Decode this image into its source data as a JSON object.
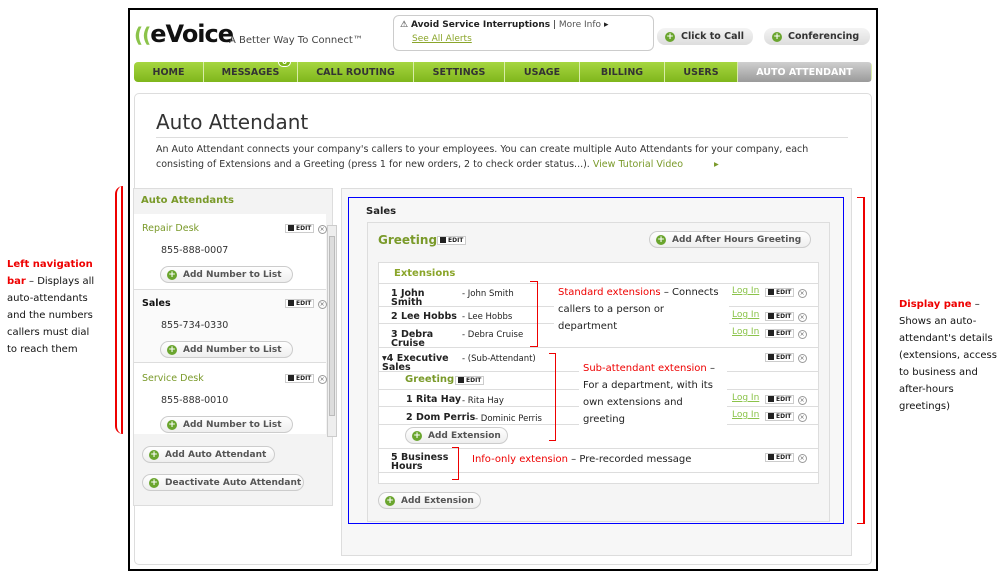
{
  "header": {
    "logo": "eVoice",
    "tagline": "A Better Way To Connect™",
    "alert_title": "Avoid Service Interruptions",
    "alert_more": "More Info",
    "alert_link": "See All Alerts",
    "click_to_call": "Click to Call",
    "conferencing": "Conferencing"
  },
  "nav": {
    "items": [
      {
        "label": "HOME"
      },
      {
        "label": "MESSAGES",
        "badge": "0"
      },
      {
        "label": "CALL ROUTING"
      },
      {
        "label": "SETTINGS"
      },
      {
        "label": "USAGE"
      },
      {
        "label": "BILLING"
      },
      {
        "label": "USERS"
      },
      {
        "label": "AUTO ATTENDANT",
        "active": true
      }
    ]
  },
  "page": {
    "title": "Auto Attendant",
    "description": "An Auto Attendant connects your company's callers to your employees. You can create multiple Auto Attendants for your company, each consisting of Extensions and a Greeting (press 1 for new orders, 2 to check order status...).",
    "tutorial_link": "View Tutorial Video"
  },
  "left_nav": {
    "heading": "Auto Attendants",
    "attendants": [
      {
        "name": "Repair Desk",
        "number": "855-888-0007"
      },
      {
        "name": "Sales",
        "number": "855-734-0330",
        "selected": true
      },
      {
        "name": "Service Desk",
        "number": "855-888-0010"
      }
    ],
    "add_number": "Add Number to List",
    "add_attendant": "Add Auto Attendant",
    "deactivate": "Deactivate Auto Attendant",
    "edit": "EDIT"
  },
  "pane": {
    "title": "Sales",
    "greeting": "Greeting:",
    "add_after_hours": "Add After Hours Greeting",
    "extensions_heading": "Extensions",
    "login": "Log In",
    "add_extension": "Add Extension",
    "extensions": [
      {
        "num": "1",
        "name": "John Smith",
        "dest": "- John Smith"
      },
      {
        "num": "2",
        "name": "Lee Hobbs",
        "dest": "- Lee Hobbs"
      },
      {
        "num": "3",
        "name": "Debra Cruise",
        "dest": "- Debra Cruise"
      },
      {
        "num": "4",
        "name": "Executive Sales",
        "dest": "- (Sub-Attendant)"
      },
      {
        "num": "5",
        "name": "Business Hours",
        "dest": ""
      }
    ],
    "sub_greeting": "Greeting",
    "sub_extensions": [
      {
        "num": "1",
        "name": "Rita Hay",
        "dest": "- Rita Hay"
      },
      {
        "num": "2",
        "name": "Dom Perris",
        "dest": "- Dominic Perris"
      }
    ]
  },
  "annotations": {
    "std_title": "Standard extensions",
    "std_text": "Connects callers to a person or department",
    "sub_title": "Sub-attendant extension",
    "sub_text": "For a department, with its own extensions and greeting",
    "info_title": "Info-only extension",
    "info_text": "Pre-recorded message",
    "left_title": "Left navigation bar",
    "left_text": "Displays all auto-attendants and the numbers callers must dial to reach them",
    "right_title": "Display pane",
    "right_text": "Shows an auto-attendant's details (extensions, access to business and after-hours greetings)"
  }
}
